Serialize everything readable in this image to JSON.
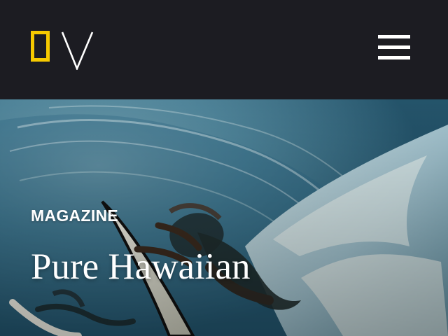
{
  "header": {
    "logo_icon": "national-geographic-logo-icon",
    "menu_icon": "hamburger-menu-icon",
    "background_color": "#1c1c22",
    "logo_color": "#f6c900"
  },
  "hero": {
    "section_label": "MAGAZINE",
    "headline": "Pure Hawaiian",
    "text_color": "#ffffff"
  }
}
